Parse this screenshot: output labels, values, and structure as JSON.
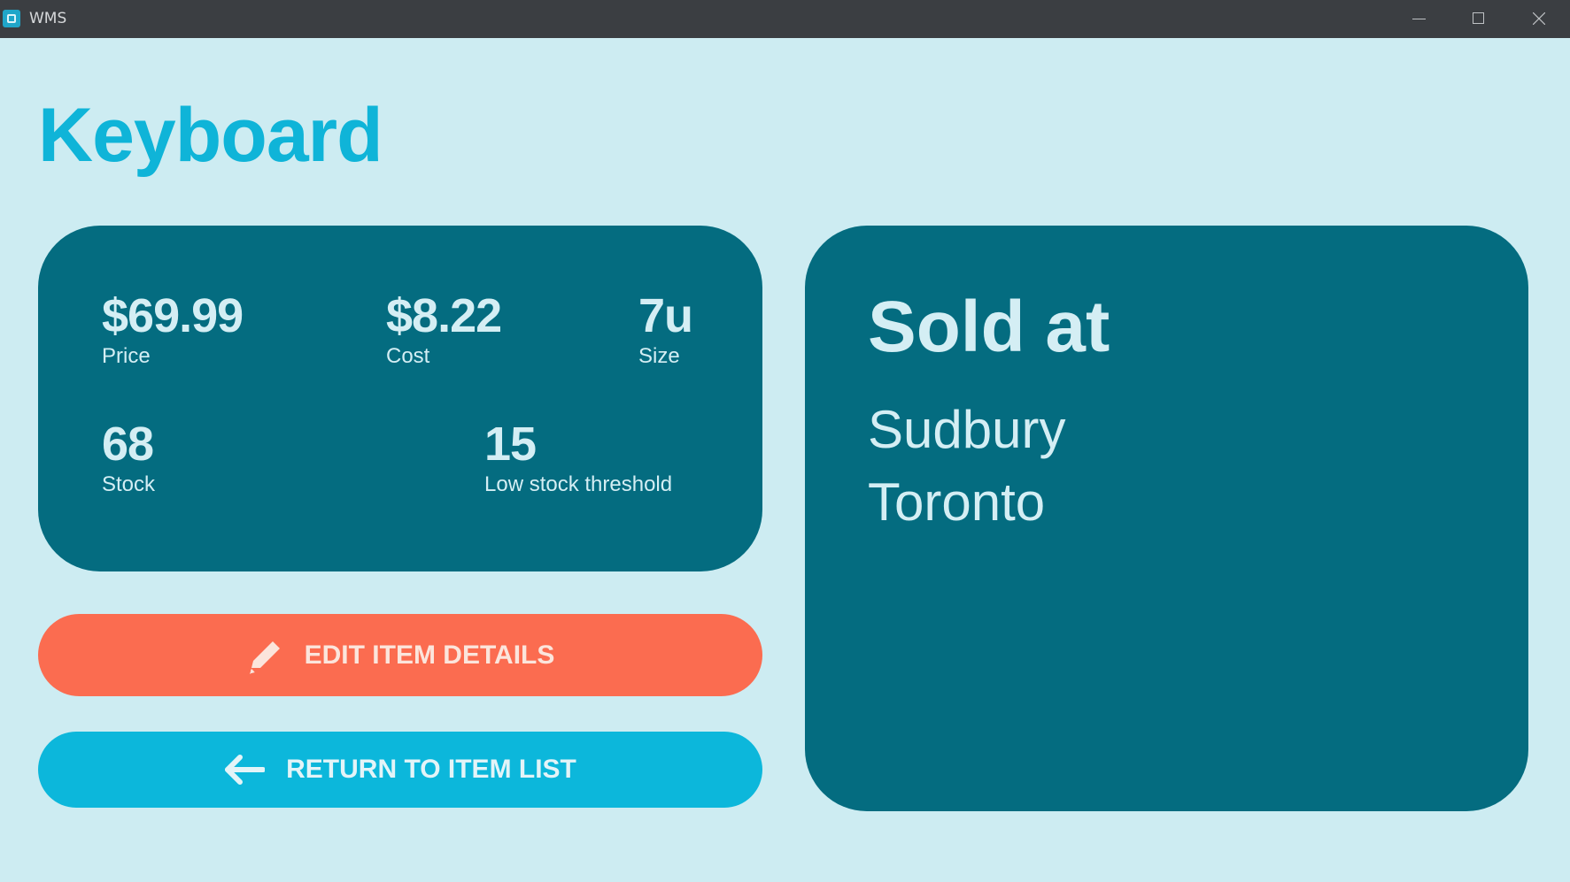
{
  "window": {
    "title": "WMS"
  },
  "item": {
    "name": "Keyboard",
    "price": "$69.99",
    "price_label": "Price",
    "cost": "$8.22",
    "cost_label": "Cost",
    "size": "7u",
    "size_label": "Size",
    "stock": "68",
    "stock_label": "Stock",
    "threshold": "15",
    "threshold_label": "Low stock threshold"
  },
  "actions": {
    "edit_label": "EDIT ITEM DETAILS",
    "edit_icon": "pencil-icon",
    "return_label": "RETURN TO ITEM LIST",
    "return_icon": "arrow-left-icon"
  },
  "sold_at": {
    "title": "Sold at",
    "locations": [
      "Sudbury",
      "Toronto"
    ]
  },
  "colors": {
    "background": "#cdecf2",
    "card": "#046c80",
    "title_accent": "#0fb4d8",
    "edit_button": "#fb6c50",
    "return_button": "#0cb7db",
    "titlebar": "#3b3e42"
  }
}
